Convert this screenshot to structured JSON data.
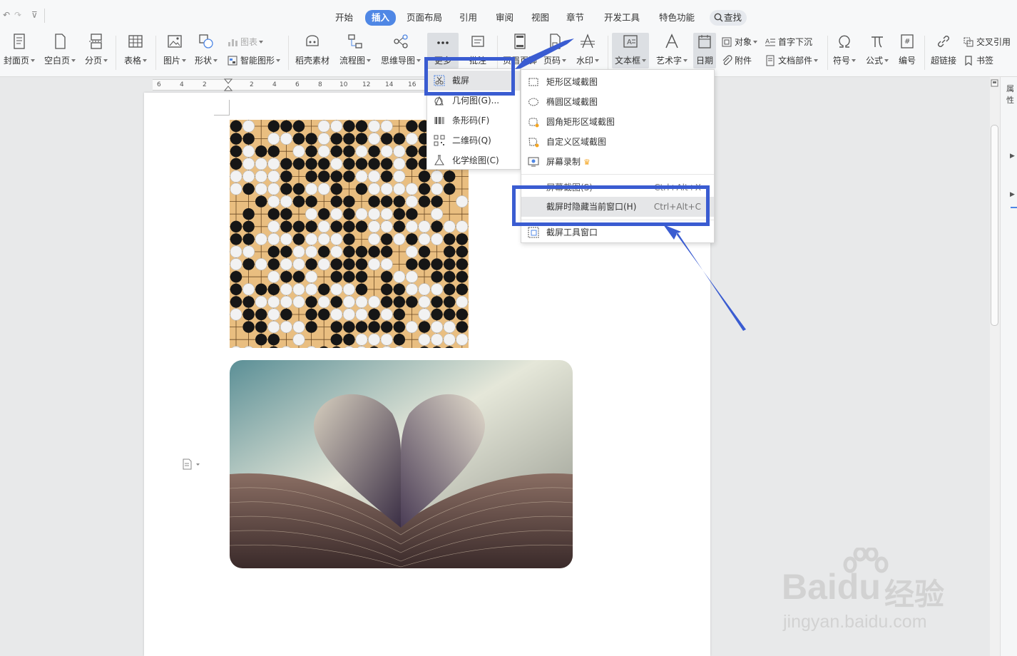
{
  "quick_access": {
    "undo": "↶",
    "redo": "↷",
    "customize": "⊽"
  },
  "tabs": [
    {
      "label": "开始"
    },
    {
      "label": "插入"
    },
    {
      "label": "页面布局"
    },
    {
      "label": "引用"
    },
    {
      "label": "审阅"
    },
    {
      "label": "视图"
    },
    {
      "label": "章节"
    },
    {
      "label": "开发工具"
    },
    {
      "label": "特色功能"
    }
  ],
  "search_label": "查找",
  "ribbon": {
    "cover": "封面页",
    "blank": "空白页",
    "pagebreak": "分页",
    "table": "表格",
    "picture": "图片",
    "shape": "形状",
    "chart": "图表",
    "smartart": "智能图形",
    "material": "稻壳素材",
    "flowchart": "流程图",
    "mindmap": "思维导图",
    "more": "更多",
    "comment": "批注",
    "header": "页眉页脚",
    "pagenum": "页码",
    "watermark": "水印",
    "textbox": "文本框",
    "arttext": "艺术字",
    "date": "日期",
    "object": "对象",
    "attachment": "附件",
    "dropcap": "首字下沉",
    "docpart": "文档部件",
    "symbol": "符号",
    "formula": "公式",
    "numbering": "编号",
    "hyperlink": "超链接",
    "crossref": "交叉引用",
    "bookmark": "书签"
  },
  "ruler_labels": [
    "6",
    "4",
    "2",
    "2",
    "4",
    "6",
    "8",
    "10",
    "12",
    "14",
    "16"
  ],
  "more_menu": [
    {
      "label": "截屏",
      "icon": "scissors-icon",
      "selected": true
    },
    {
      "label": "几何图(G)...",
      "icon": "geometry-icon"
    },
    {
      "label": "条形码(F)",
      "icon": "barcode-icon"
    },
    {
      "label": "二维码(Q)",
      "icon": "qrcode-icon"
    },
    {
      "label": "化学绘图(C)",
      "icon": "flask-icon"
    }
  ],
  "screenshot_menu": {
    "items_top": [
      {
        "label": "矩形区域截图",
        "icon": "rect-select-icon"
      },
      {
        "label": "椭圆区域截图",
        "icon": "ellipse-select-icon"
      },
      {
        "label": "圆角矩形区域截图",
        "icon": "rounded-rect-select-icon"
      },
      {
        "label": "自定义区域截图",
        "icon": "custom-select-icon"
      },
      {
        "label": "屏幕录制",
        "icon": "screen-record-icon",
        "crown": "♛"
      }
    ],
    "hidden_item": {
      "label": "屏幕截图(S)",
      "shortcut": "Ctrl+Alt+X"
    },
    "hide_window": {
      "label": "截屏时隐藏当前窗口(H)",
      "shortcut": "Ctrl+Alt+C"
    },
    "tool_window": {
      "label": "截屏工具窗口",
      "icon": "tool-window-icon"
    }
  },
  "side_panel": {
    "label": "属性"
  },
  "watermark": {
    "brand": "Baidu",
    "cn": "经验",
    "url": "jingyan.baidu.com"
  },
  "colors": {
    "accent": "#4f87e5",
    "annotation": "#3a5cd1"
  }
}
